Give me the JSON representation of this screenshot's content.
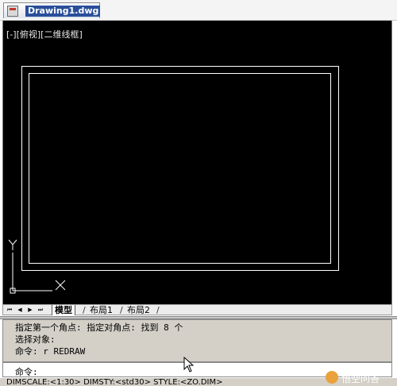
{
  "document": {
    "title": "Drawing1.dwg"
  },
  "viewport": {
    "label_parts": [
      "[-]",
      "[俯视]",
      "[二维线框]"
    ]
  },
  "layout_tabs": {
    "model": "模型",
    "layout1": "布局1",
    "layout2": "布局2",
    "nav_buttons": [
      "⏮",
      "◀",
      "▶",
      "⏭"
    ]
  },
  "command": {
    "history": [
      "指定第一个角点: 指定对角点: 找到 8 个",
      "选择对象:",
      "命令: r REDRAW"
    ],
    "prompt": "命令:"
  },
  "status_text": "DIMSCALE:<1:30> DIMSTY:<std30> STYLE:<ZO.DIM>",
  "watermark": "悟空问答",
  "colors": {
    "background": "#000000",
    "lines": "#ffffff",
    "title_bg": "#2a4f9a"
  },
  "icons": {
    "ucs": "ucs-icon",
    "cursor": "mouse-cursor-icon",
    "document": "dwg-file-icon",
    "watermark": "wukong-logo-icon"
  }
}
